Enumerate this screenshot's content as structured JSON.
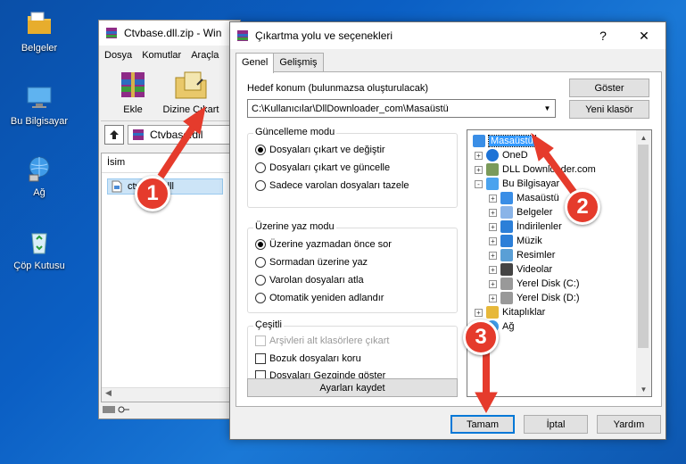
{
  "desktop": {
    "icons": [
      {
        "label": "Belgeler",
        "icon": "folder-documents-icon"
      },
      {
        "label": "Bu Bilgisayar",
        "icon": "computer-icon"
      },
      {
        "label": "Ağ",
        "icon": "network-icon"
      },
      {
        "label": "Çöp Kutusu",
        "icon": "recycle-bin-icon"
      }
    ]
  },
  "winrar": {
    "title": "Ctvbase.dll.zip - Win",
    "menu": [
      "Dosya",
      "Komutlar",
      "Araçla"
    ],
    "tools": {
      "add_label": "Ekle",
      "extract_label": "Dizine Çıkart"
    },
    "path": "Ctvbase.dll",
    "list_header": "İsim",
    "file_name": "ctvbase.dll"
  },
  "dialog": {
    "title": "Çıkartma yolu ve seçenekleri",
    "help": "?",
    "close": "✕",
    "tabs": [
      "Genel",
      "Gelişmiş"
    ],
    "destination_label": "Hedef konum (bulunmazsa oluşturulacak)",
    "destination_value": "C:\\Kullanıcılar\\DllDownloader_com\\Masaüstü",
    "show_button": "Göster",
    "new_folder_button": "Yeni klasör",
    "update_mode": {
      "title": "Güncelleme modu",
      "options": [
        "Dosyaları çıkart ve değiştir",
        "Dosyaları çıkart ve güncelle",
        "Sadece varolan dosyaları tazele"
      ],
      "selected": 0
    },
    "overwrite_mode": {
      "title": "Üzerine yaz modu",
      "options": [
        "Üzerine yazmadan önce sor",
        "Sormadan üzerine yaz",
        "Varolan dosyaları atla",
        "Otomatik yeniden adlandır"
      ],
      "selected": 0
    },
    "misc": {
      "title": "Çeşitli",
      "options": [
        "Arşivleri alt klasörlere çıkart",
        "Bozuk dosyaları koru",
        "Dosyaları Gezginde göster"
      ]
    },
    "save_settings": "Ayarları kaydet",
    "tree": [
      {
        "label": "Masaüstü",
        "level": 0,
        "selected": true,
        "expander": "",
        "icon": "desktop-icon"
      },
      {
        "label": "OneD",
        "level": 1,
        "expander": "+",
        "icon": "cloud-icon"
      },
      {
        "label": "DLL Downloader.com",
        "level": 1,
        "expander": "+",
        "icon": "user-icon"
      },
      {
        "label": "Bu Bilgisayar",
        "level": 1,
        "expander": "-",
        "icon": "computer-icon"
      },
      {
        "label": "Masaüstü",
        "level": 2,
        "expander": "+",
        "icon": "desktop-icon"
      },
      {
        "label": "Belgeler",
        "level": 2,
        "expander": "+",
        "icon": "document-icon"
      },
      {
        "label": "İndirilenler",
        "level": 2,
        "expander": "+",
        "icon": "download-icon"
      },
      {
        "label": "Müzik",
        "level": 2,
        "expander": "+",
        "icon": "music-icon"
      },
      {
        "label": "Resimler",
        "level": 2,
        "expander": "+",
        "icon": "pictures-icon"
      },
      {
        "label": "Videolar",
        "level": 2,
        "expander": "+",
        "icon": "video-icon"
      },
      {
        "label": "Yerel Disk (C:)",
        "level": 2,
        "expander": "+",
        "icon": "drive-icon"
      },
      {
        "label": "Yerel Disk (D:)",
        "level": 2,
        "expander": "+",
        "icon": "drive-icon"
      },
      {
        "label": "Kitaplıklar",
        "level": 1,
        "expander": "+",
        "icon": "library-icon"
      },
      {
        "label": "Ağ",
        "level": 1,
        "expander": "+",
        "icon": "network-icon"
      }
    ],
    "ok": "Tamam",
    "cancel": "İptal",
    "help_button": "Yardım"
  },
  "callouts": [
    "1",
    "2",
    "3"
  ],
  "colors": {
    "accent": "#0078d7",
    "callout": "#e53b2c",
    "selection": "#cce8ff"
  }
}
